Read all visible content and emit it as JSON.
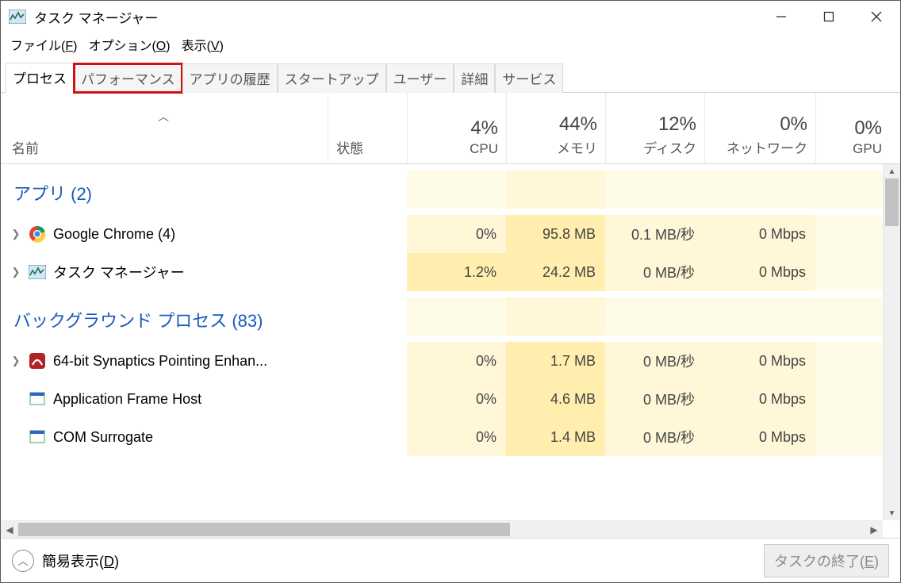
{
  "titlebar": {
    "title": "タスク マネージャー"
  },
  "menubar": {
    "file_pre": "ファイル(",
    "file_key": "F",
    "file_post": ")",
    "options_pre": "オプション(",
    "options_key": "O",
    "options_post": ")",
    "view_pre": "表示(",
    "view_key": "V",
    "view_post": ")"
  },
  "tabs": {
    "processes": "プロセス",
    "performance": "パフォーマンス",
    "app_history": "アプリの履歴",
    "startup": "スタートアップ",
    "users": "ユーザー",
    "details": "詳細",
    "services": "サービス"
  },
  "columns": {
    "name": "名前",
    "status": "状態",
    "cpu_pct": "4%",
    "cpu_label": "CPU",
    "mem_pct": "44%",
    "mem_label": "メモリ",
    "disk_pct": "12%",
    "disk_label": "ディスク",
    "net_pct": "0%",
    "net_label": "ネットワーク",
    "gpu_pct": "0%",
    "gpu_label": "GPU"
  },
  "groups": {
    "apps": "アプリ (2)",
    "background": "バックグラウンド プロセス (83)"
  },
  "rows": {
    "chrome": {
      "name": "Google Chrome (4)",
      "cpu": "0%",
      "mem": "95.8 MB",
      "disk": "0.1 MB/秒",
      "net": "0 Mbps"
    },
    "tm": {
      "name": "タスク マネージャー",
      "cpu": "1.2%",
      "mem": "24.2 MB",
      "disk": "0 MB/秒",
      "net": "0 Mbps"
    },
    "syn": {
      "name": "64-bit Synaptics Pointing Enhan...",
      "cpu": "0%",
      "mem": "1.7 MB",
      "disk": "0 MB/秒",
      "net": "0 Mbps"
    },
    "afh": {
      "name": "Application Frame Host",
      "cpu": "0%",
      "mem": "4.6 MB",
      "disk": "0 MB/秒",
      "net": "0 Mbps"
    },
    "com": {
      "name": "COM Surrogate",
      "cpu": "0%",
      "mem": "1.4 MB",
      "disk": "0 MB/秒",
      "net": "0 Mbps"
    }
  },
  "footer": {
    "fewer_pre": "簡易表示(",
    "fewer_key": "D",
    "fewer_post": ")",
    "end_task_pre": "タスクの終了(",
    "end_task_key": "E",
    "end_task_post": ")"
  }
}
